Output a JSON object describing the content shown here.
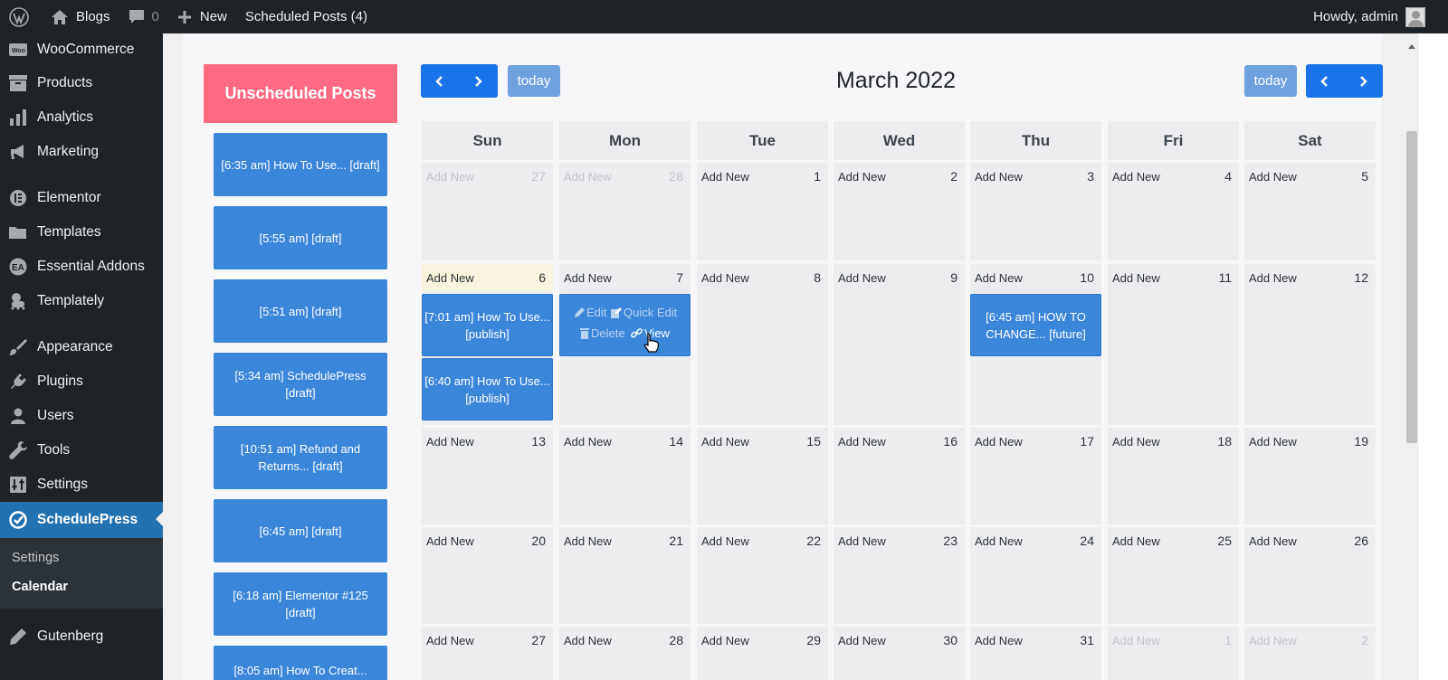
{
  "adminbar": {
    "site_name": "Blogs",
    "comments_count": "0",
    "new_label": "New",
    "scheduled_label": "Scheduled Posts (4)",
    "greeting": "Howdy, admin"
  },
  "sidebar": {
    "items": [
      {
        "label": "WooCommerce",
        "icon": "woo-icon"
      },
      {
        "label": "Products",
        "icon": "archive-icon"
      },
      {
        "label": "Analytics",
        "icon": "bar-chart-icon"
      },
      {
        "label": "Marketing",
        "icon": "megaphone-icon"
      },
      {
        "label": "Elementor",
        "icon": "elementor-icon"
      },
      {
        "label": "Templates",
        "icon": "folder-icon"
      },
      {
        "label": "Essential Addons",
        "icon": "ea-icon"
      },
      {
        "label": "Templately",
        "icon": "templately-icon"
      },
      {
        "label": "Appearance",
        "icon": "brush-icon"
      },
      {
        "label": "Plugins",
        "icon": "plug-icon"
      },
      {
        "label": "Users",
        "icon": "user-icon"
      },
      {
        "label": "Tools",
        "icon": "wrench-icon"
      },
      {
        "label": "Settings",
        "icon": "sliders-icon"
      },
      {
        "label": "SchedulePress",
        "icon": "schedulepress-icon"
      },
      {
        "label": "Gutenberg",
        "icon": "pen-icon"
      }
    ],
    "submenu": [
      {
        "label": "Settings"
      },
      {
        "label": "Calendar"
      }
    ]
  },
  "unscheduled": {
    "title": "Unscheduled Posts",
    "posts": [
      "[6:35 am] How To Use... [draft]",
      "[5:55 am] [draft]",
      "[5:51 am] [draft]",
      "[5:34 am] SchedulePress [draft]",
      "[10:51 am] Refund and Returns... [draft]",
      "[6:45 am] [draft]",
      "[6:18 am] Elementor #125 [draft]",
      "[8:05 am] How To Creat..."
    ]
  },
  "toolbar": {
    "today_label": "today",
    "title": "March 2022"
  },
  "calendar": {
    "add_new_label": "Add New",
    "weekdays": [
      "Sun",
      "Mon",
      "Tue",
      "Wed",
      "Thu",
      "Fri",
      "Sat"
    ],
    "weeks": [
      [
        "27",
        "28",
        "1",
        "2",
        "3",
        "4",
        "5"
      ],
      [
        "6",
        "7",
        "8",
        "9",
        "10",
        "11",
        "12"
      ],
      [
        "13",
        "14",
        "15",
        "16",
        "17",
        "18",
        "19"
      ],
      [
        "20",
        "21",
        "22",
        "23",
        "24",
        "25",
        "26"
      ],
      [
        "27",
        "28",
        "29",
        "30",
        "31",
        "1",
        "2"
      ]
    ],
    "events": {
      "sun6_a": "[7:01 am] How To Use... [publish]",
      "sun6_b": "[6:40 am] How To Use... [publish]",
      "thu10": "[6:45 am] HOW TO CHANGE... [future]"
    },
    "hover_actions": {
      "edit": "Edit",
      "quick_edit": "Quick Edit",
      "delete": "Delete",
      "view": "View"
    }
  },
  "colors": {
    "admin_bg": "#1d2327",
    "active_menu": "#2271b1",
    "unscheduled_header": "#ff6a82",
    "event_blue": "#3a87d9",
    "nav_button": "#1a73e8",
    "today_button": "#6fa1e0"
  }
}
